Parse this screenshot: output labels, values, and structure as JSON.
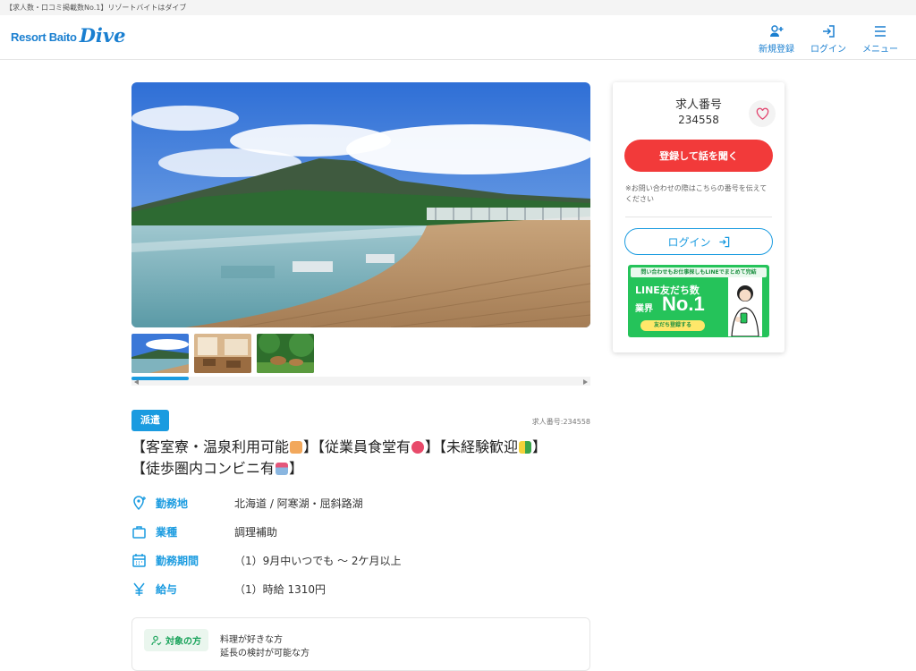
{
  "top_notice": "【求人数・口コミ掲載数No.1】リゾートバイトはダイブ",
  "logo": {
    "resort": "Resort Baito",
    "dive": "Dive"
  },
  "nav": {
    "register": "新規登録",
    "login": "ログイン",
    "menu": "メニュー"
  },
  "job": {
    "type_badge": "派遣",
    "job_number_small": "求人番号:234558",
    "title_parts": [
      "【客室寮・温泉利用可能",
      "】【従業員食堂有",
      "】【未経験歓迎",
      "】",
      "【徒歩圏内コンビニ有",
      "】"
    ],
    "info": {
      "location_label": "勤務地",
      "location_value": "北海道 / 阿寒湖・屈斜路湖",
      "category_label": "業種",
      "category_value": "調理補助",
      "period_label": "勤務期間",
      "period_value": "（1）9月中いつでも ～ 2ケ月以上",
      "wage_label": "給与",
      "wage_value": "（1）時給 1310円"
    },
    "target": {
      "chip_label": "対象の方",
      "line1": "料理が好きな方",
      "line2": "延長の検討が可能な方"
    }
  },
  "side": {
    "job_number_label": "求人番号",
    "job_number": "234558",
    "register_button": "登録して話を聞く",
    "note": "※お問い合わせの際はこちらの番号を伝えてください",
    "login_button": "ログイン",
    "line_banner": {
      "top": "問い合わせもお仕事探しもLINEでまとめて完結",
      "line1": "LINE友だち数",
      "line2a": "業界",
      "line2b": "No.1",
      "button": "友だち登録する"
    }
  },
  "colors": {
    "brand_blue": "#1a9be0",
    "register_red": "#f23a3a",
    "line_green": "#25c35a"
  }
}
